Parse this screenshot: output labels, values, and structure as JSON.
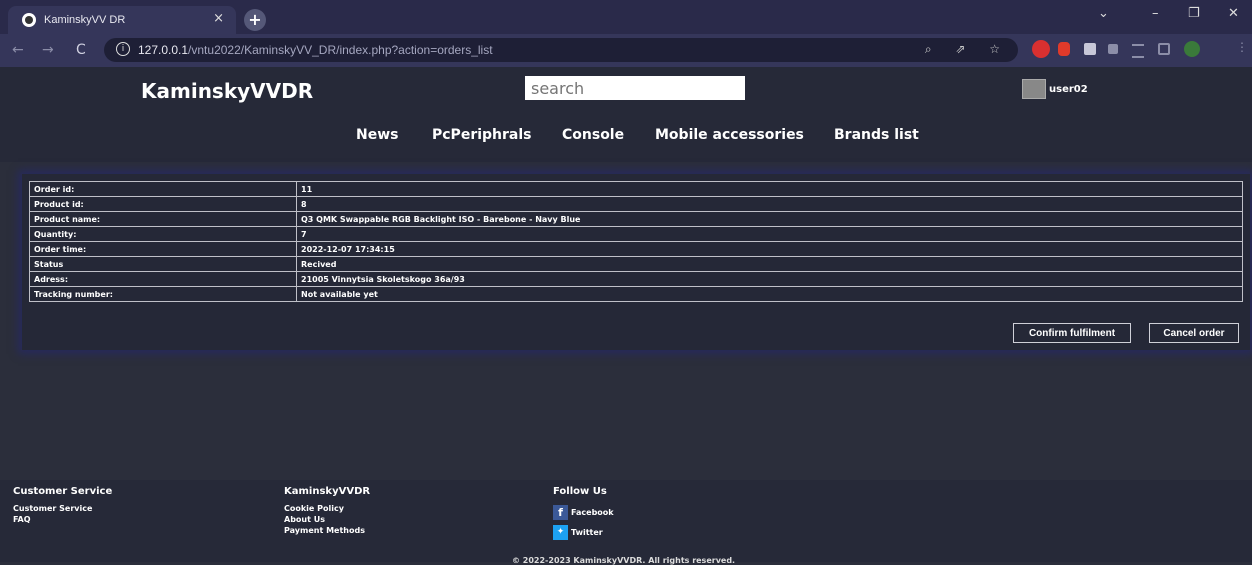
{
  "browser": {
    "tab_title": "KaminskyVV DR",
    "tab_close": "×",
    "new_tab": "+",
    "back": "←",
    "forward": "→",
    "reload": "C",
    "url_host": "127.0.0.1",
    "url_path": "/vntu2022/KaminskyVV_DR/index.php?action=orders_list",
    "window_min": "–",
    "window_max": "❐",
    "window_close": "✕",
    "chevron": "⌄"
  },
  "header": {
    "brand": "KaminskyVVDR",
    "search_placeholder": "search",
    "username": "user02"
  },
  "menu": [
    "News",
    "PcPeriphrals",
    "Console",
    "Mobile accessories",
    "Brands list"
  ],
  "order": {
    "rows": [
      {
        "label": "Order id:",
        "value": "11"
      },
      {
        "label": "Product id:",
        "value": "8"
      },
      {
        "label": "Product name:",
        "value": "Q3 QMK Swappable RGB Backlight ISO - Barebone - Navy Blue"
      },
      {
        "label": "Quantity:",
        "value": "7"
      },
      {
        "label": "Order time:",
        "value": "2022-12-07 17:34:15"
      },
      {
        "label": "Status",
        "value": "Recived"
      },
      {
        "label": "Adress:",
        "value": "21005 Vinnytsia Skoletskogo 36a/93"
      },
      {
        "label": "Tracking number:",
        "value": "Not available yet"
      }
    ],
    "confirm_label": "Confirm fulfilment",
    "cancel_label": "Cancel order"
  },
  "footer": {
    "col1": {
      "title": "Customer Service",
      "links": [
        "Customer Service",
        "FAQ"
      ]
    },
    "col2": {
      "title": "KaminskyVVDR",
      "links": [
        "Cookie Policy",
        "About Us",
        "Payment Methods"
      ]
    },
    "col3": {
      "title": "Follow Us",
      "links": [
        "Facebook",
        "Twitter"
      ]
    },
    "copyright": "© 2022-2023 KaminskyVVDR. All rights reserved."
  },
  "colors": {
    "page_bg": "#2b2e3b",
    "header_bg": "#262938",
    "card_glow": "#272a5c",
    "facebook": "#3b5998",
    "twitter": "#1da1f2"
  }
}
